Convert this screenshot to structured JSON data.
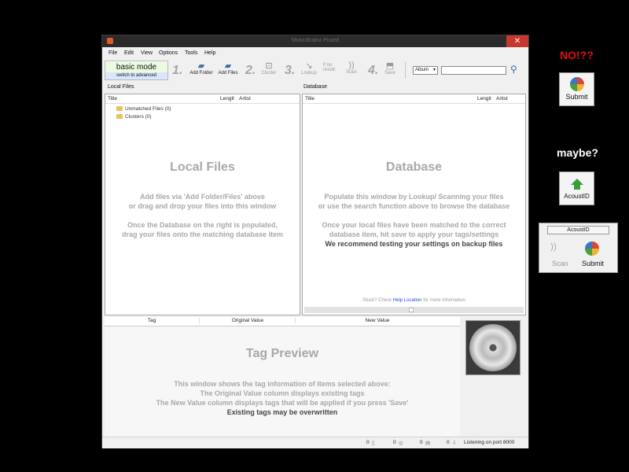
{
  "window": {
    "title": "MusicBrainz Picard",
    "close_glyph": "✕"
  },
  "menu": [
    "File",
    "Edit",
    "View",
    "Options",
    "Tools",
    "Help"
  ],
  "toolbar": {
    "mode_title": "basic mode",
    "mode_switch": "switch to advanced",
    "step1": "1.",
    "step2": "2.",
    "step3": "3.",
    "step4": "4.",
    "add_folder": "Add Folder",
    "add_files": "Add Files",
    "cluster": "Cluster",
    "lookup": "Lookup",
    "if_no_result_1": "if no",
    "if_no_result_2": "result:",
    "scan": "Scan",
    "save": "Save",
    "search_type": "Album",
    "search_value": ""
  },
  "local_files": {
    "header": "Local Files",
    "col_title": "Title",
    "col_length": "Lengtl",
    "col_artist": "Artist",
    "tree": [
      "Unmatched Files (0)",
      "Clusters (0)"
    ],
    "big_title": "Local Files",
    "help": [
      "Add files via 'Add Folder/Files' above",
      "or drag and drop your files into this window",
      "",
      "Once the Database on the right is populated,",
      "drag your files onto the matching database item"
    ]
  },
  "database": {
    "header": "Database",
    "col_title": "Title",
    "col_length": "Lengtl",
    "col_artist": "Artist",
    "big_title": "Database",
    "help": [
      "Populate this window by Lookup/ Scanning your files",
      "or use the search function above to browse the database",
      "",
      "Once your local files have been matched to the correct",
      "database item, hit save to apply your tags/settings"
    ],
    "recommend": "We recommend testing your settings on backup files",
    "stuck_prefix": "Stuck? Check",
    "stuck_link": "Help Location",
    "stuck_suffix": "for more information"
  },
  "tag_preview": {
    "col_tag": "Tag",
    "col_original": "Original Value",
    "col_new": "New Value",
    "big_title": "Tag Preview",
    "help": [
      "This window shows the tag information of items selected above:",
      "The Original Value column displays existing tags",
      "The New Value column displays tags that will be applied if you press 'Save'"
    ],
    "warning": "Existing tags may be overwritten"
  },
  "statusbar": {
    "count1": "0",
    "count2": "0",
    "count3": "0",
    "count4": "0",
    "listening": "Listening on port 8000"
  },
  "annotations": {
    "no": "NO!??",
    "maybe": "maybe?",
    "submit_label": "Submit",
    "acoustid_label": "AcoustID",
    "group_header": "AcoustID",
    "group_scan": "Scan",
    "group_submit": "Submit"
  },
  "colors": {
    "accent_red": "#e01010",
    "close_red": "#c7372f",
    "brand_green": "#3d9b3a"
  }
}
